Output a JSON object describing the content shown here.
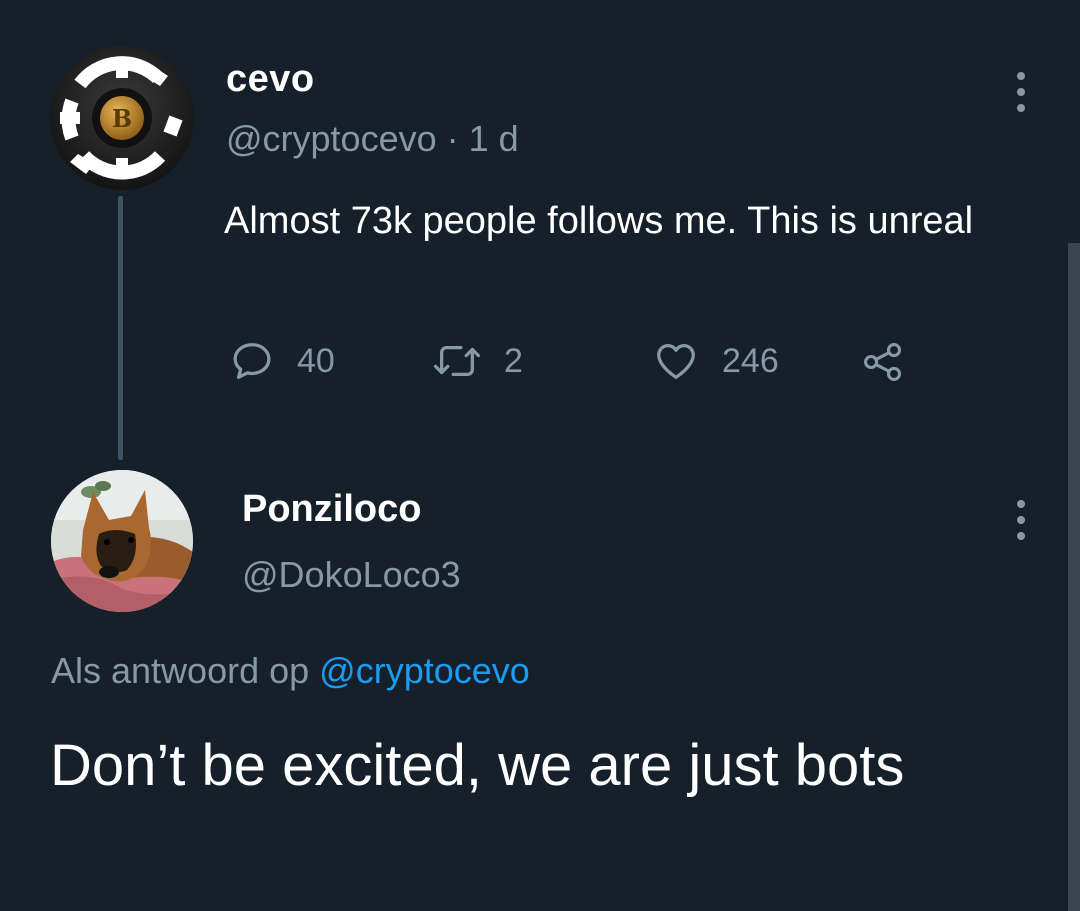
{
  "tweet": {
    "author_name": "cevo",
    "author_handle": "@cryptocevo",
    "separator": " · ",
    "time": "1 d",
    "text": "Almost 73k people follows me. This is unreal",
    "replies": "40",
    "retweets": "2",
    "likes": "246",
    "icons": {
      "more": "more-vertical-icon",
      "reply": "comment-icon",
      "retweet": "retweet-icon",
      "like": "heart-icon",
      "share": "share-icon"
    }
  },
  "reply": {
    "author_name": "Ponziloco",
    "author_handle": "@DokoLoco3",
    "context_prefix": "Als antwoord op ",
    "context_handle": "@cryptocevo",
    "text": "Don’t be excited, we are just bots"
  },
  "colors": {
    "background": "#15202b",
    "secondary_text": "#8899a6",
    "link": "#1d9bf0",
    "thread_line": "#3d5466"
  }
}
